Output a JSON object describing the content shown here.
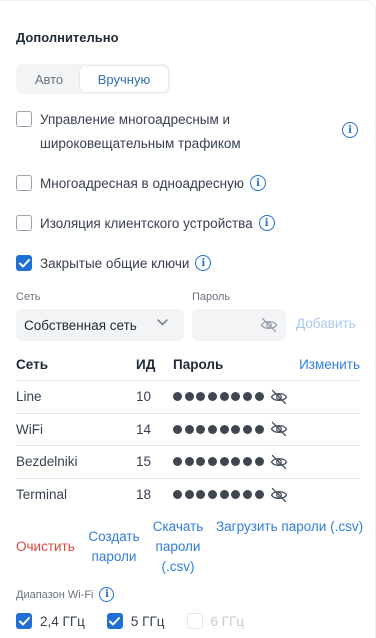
{
  "section": {
    "title": "Дополнительно"
  },
  "mode": {
    "auto": "Авто",
    "manual": "Вручную",
    "selected": "Вручную"
  },
  "options": [
    {
      "label": "Управление многоадресным и широковещательным трафиком",
      "line1": "Управление многоадресным и",
      "line2": "широковещательным трафиком",
      "checked": false
    },
    {
      "label": "Многоадресная в одноадресную",
      "checked": false
    },
    {
      "label": "Изоляция клиентского устройства",
      "checked": false
    },
    {
      "label": "Закрытые общие ключи",
      "checked": true
    }
  ],
  "form": {
    "network_label": "Сеть",
    "network_value": "Собственная сеть",
    "password_label": "Пароль",
    "password_value": "",
    "add_label": "Добавить"
  },
  "table": {
    "headers": {
      "network": "Сеть",
      "id": "ИД",
      "password": "Пароль",
      "edit": "Изменить"
    },
    "rows": [
      {
        "network": "Line",
        "id": "10",
        "password_mask": "●●●●●●●●"
      },
      {
        "network": "WiFi",
        "id": "14",
        "password_mask": "●●●●●●●●"
      },
      {
        "network": "Bezdelniki",
        "id": "15",
        "password_mask": "●●●●●●●●"
      },
      {
        "network": "Terminal",
        "id": "18",
        "password_mask": "●●●●●●●●"
      }
    ]
  },
  "actions": {
    "clear": "Очистить",
    "create_line1": "Создать",
    "create_line2": "пароли",
    "download_line1": "Скачать",
    "download_line2": "пароли",
    "download_line3": "(.csv)",
    "upload": "Загрузить пароли (.csv)"
  },
  "wifi": {
    "label": "Диапазон Wi-Fi",
    "bands": [
      {
        "label": "2,4 ГГц",
        "checked": true,
        "enabled": true
      },
      {
        "label": "5 ГГц",
        "checked": true,
        "enabled": true
      },
      {
        "label": "6 ГГц",
        "checked": false,
        "enabled": false
      }
    ]
  },
  "colors": {
    "accent": "#1f6fd6",
    "link": "#2f7de1",
    "danger": "#e0483b",
    "muted_link": "#a9c9ef"
  },
  "icons": {
    "info": "info-icon",
    "eye": "eye-off-icon",
    "chevron": "chevron-down-icon",
    "check": "check-icon"
  }
}
